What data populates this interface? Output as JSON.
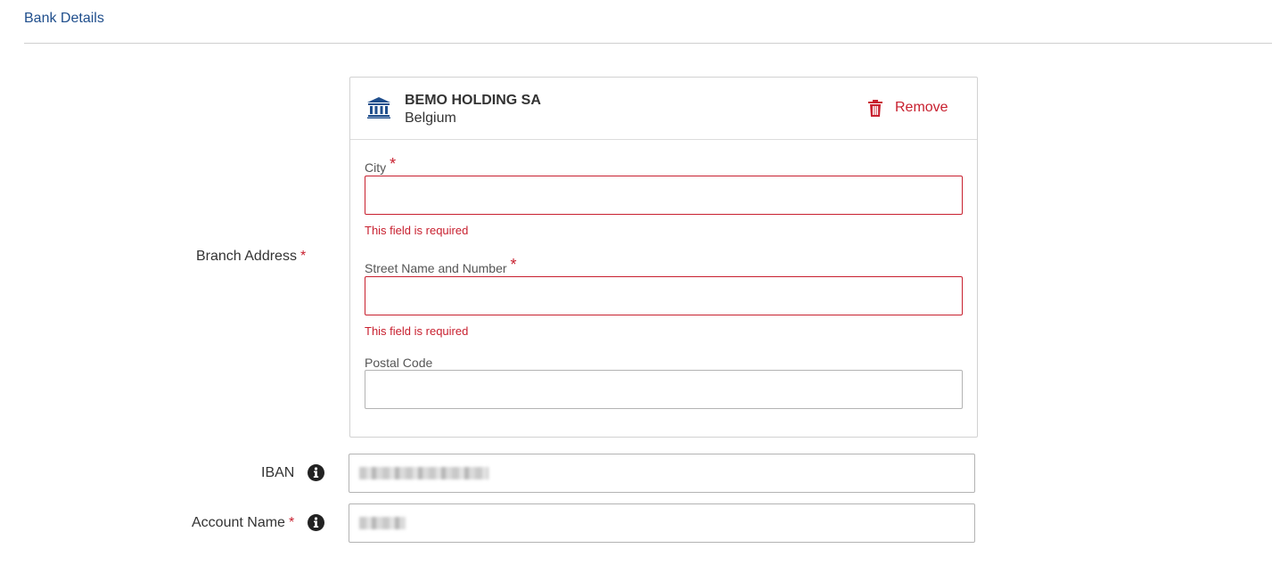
{
  "section": {
    "title": "Bank Details"
  },
  "branch_address": {
    "label": "Branch Address",
    "required_mark": "*"
  },
  "bank": {
    "icon": "bank-icon",
    "name": "BEMO HOLDING SA",
    "country": "Belgium",
    "remove_label": "Remove",
    "remove_icon": "trash-icon"
  },
  "fields": {
    "city": {
      "label": "City",
      "required_mark": "*",
      "value": "",
      "error": "This field is required"
    },
    "street": {
      "label": "Street Name and Number",
      "required_mark": "*",
      "value": "",
      "error": "This field is required"
    },
    "postal": {
      "label": "Postal Code",
      "value": ""
    }
  },
  "iban": {
    "label": "IBAN",
    "icon": "info-icon"
  },
  "account_name": {
    "label": "Account Name",
    "required_mark": "*",
    "icon": "info-icon"
  },
  "colors": {
    "accent": "#1f4e8c",
    "error": "#c8202f",
    "bank_icon": "#1f4e8c"
  }
}
